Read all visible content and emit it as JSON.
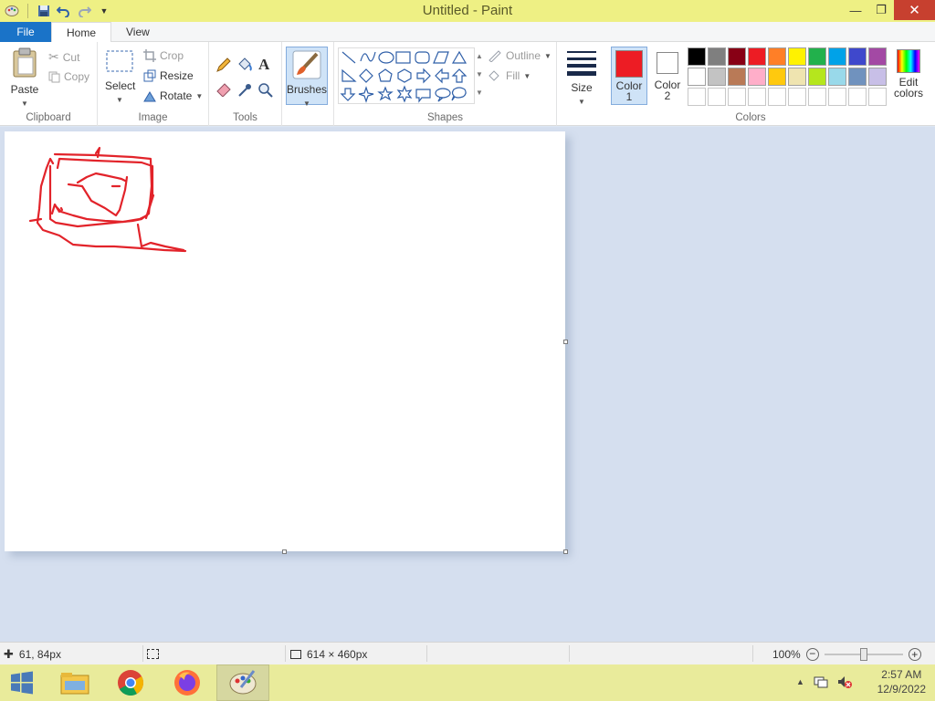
{
  "window": {
    "title": "Untitled - Paint"
  },
  "tabs": {
    "file": "File",
    "home": "Home",
    "view": "View"
  },
  "clipboard": {
    "paste": "Paste",
    "cut": "Cut",
    "copy": "Copy",
    "group": "Clipboard"
  },
  "image": {
    "select": "Select",
    "crop": "Crop",
    "resize": "Resize",
    "rotate": "Rotate",
    "group": "Image"
  },
  "tools": {
    "group": "Tools"
  },
  "brushes": {
    "label": "Brushes"
  },
  "shapes": {
    "outline": "Outline",
    "fill": "Fill",
    "group": "Shapes"
  },
  "size": {
    "label": "Size"
  },
  "colors": {
    "color1_label": "Color",
    "color1_num": "1",
    "color2_label": "Color",
    "color2_num": "2",
    "color1_value": "#ed1c24",
    "color2_value": "#ffffff",
    "edit_label": "Edit",
    "edit_label2": "colors",
    "group": "Colors",
    "palette_row1": [
      "#000000",
      "#7f7f7f",
      "#880015",
      "#ed1c24",
      "#ff7f27",
      "#fff200",
      "#22b14c",
      "#00a2e8",
      "#3f48cc",
      "#a349a4"
    ],
    "palette_row2": [
      "#ffffff",
      "#c3c3c3",
      "#b97a57",
      "#ffaec9",
      "#ffc90e",
      "#efe4b0",
      "#b5e61d",
      "#99d9ea",
      "#7092be",
      "#c8bfe7"
    ]
  },
  "status": {
    "cursor_pos": "61, 84px",
    "canvas_size": "614 × 460px",
    "zoom": "100%"
  },
  "taskbar": {
    "time": "2:57 AM",
    "date": "12/9/2022"
  },
  "drawing": {
    "stroke_color": "#e2232a"
  }
}
